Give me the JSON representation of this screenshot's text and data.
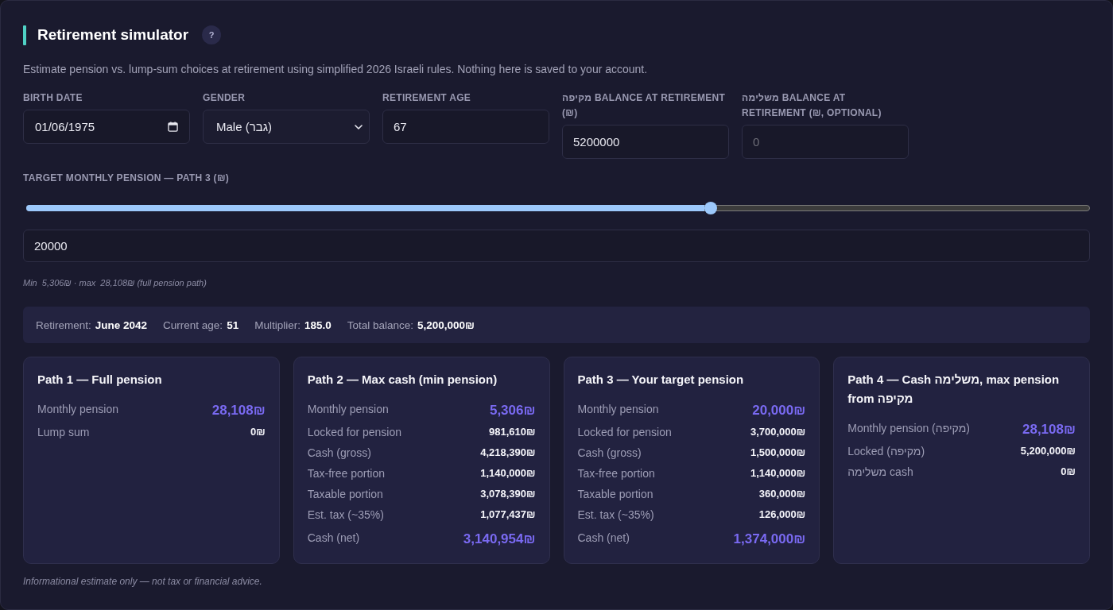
{
  "header": {
    "title": "Retirement simulator",
    "help_button": "?"
  },
  "description": "Estimate pension vs. lump-sum choices at retirement using simplified 2026 Israeli rules. Nothing here is saved to your account.",
  "fields": [
    {
      "kind": "date",
      "label": "BIRTH DATE",
      "value": "01/06/1975"
    },
    {
      "kind": "select",
      "label": "GENDER",
      "value": "Male (גבר)"
    },
    {
      "kind": "number",
      "label": "RETIREMENT AGE",
      "value": "67"
    },
    {
      "kind": "number",
      "label": "מקיפה BALANCE AT RETIREMENT (₪)",
      "value": "5200000"
    },
    {
      "kind": "number",
      "label": "משלימה BALANCE AT RETIREMENT (₪, OPTIONAL)",
      "placeholder": "0"
    }
  ],
  "target_pension": {
    "label": "TARGET MONTHLY PENSION — PATH 3 (₪)",
    "level": 0.644,
    "value": "20000",
    "hint": "Min  5,306₪ · max  28,108₪ (full pension path)"
  },
  "summary": [
    {
      "label": "Retirement:",
      "value": "June 2042"
    },
    {
      "label": "Current age:",
      "value": "51"
    },
    {
      "label": "Multiplier:",
      "value": "185.0"
    },
    {
      "label": "Total balance:",
      "value": "5,200,000₪"
    }
  ],
  "paths": [
    {
      "title": "Path 1 — Full pension",
      "rows": [
        {
          "kind": "accent",
          "label": "Monthly pension",
          "value": "28,108₪"
        },
        {
          "kind": "plain",
          "label": "Lump sum",
          "value": "0₪"
        }
      ]
    },
    {
      "title": "Path 2 — Max cash (min pension)",
      "rows": [
        {
          "kind": "accent",
          "label": "Monthly pension",
          "value": "5,306₪"
        },
        {
          "kind": "plain",
          "label": "Locked for pension",
          "value": "981,610₪"
        },
        {
          "kind": "plain",
          "label": "Cash (gross)",
          "value": "4,218,390₪"
        },
        {
          "kind": "plain",
          "label": "Tax-free portion",
          "value": "1,140,000₪"
        },
        {
          "kind": "plain",
          "label": "Taxable portion",
          "value": "3,078,390₪"
        },
        {
          "kind": "plain",
          "label": "Est. tax (~35%)",
          "value": "1,077,437₪"
        },
        {
          "kind": "accent",
          "label": "Cash (net)",
          "value": "3,140,954₪"
        }
      ]
    },
    {
      "title": "Path 3 — Your target pension",
      "rows": [
        {
          "kind": "accent",
          "label": "Monthly pension",
          "value": "20,000₪"
        },
        {
          "kind": "plain",
          "label": "Locked for pension",
          "value": "3,700,000₪"
        },
        {
          "kind": "plain",
          "label": "Cash (gross)",
          "value": "1,500,000₪"
        },
        {
          "kind": "plain",
          "label": "Tax-free portion",
          "value": "1,140,000₪"
        },
        {
          "kind": "plain",
          "label": "Taxable portion",
          "value": "360,000₪"
        },
        {
          "kind": "plain",
          "label": "Est. tax (~35%)",
          "value": "126,000₪"
        },
        {
          "kind": "accent",
          "label": "Cash (net)",
          "value": "1,374,000₪"
        }
      ]
    },
    {
      "title": "Path 4 — Cash משלימה, max pension from מקיפה",
      "rows": [
        {
          "kind": "accent",
          "label": "Monthly pension (מקיפה)",
          "value": "28,108₪"
        },
        {
          "kind": "plain",
          "label": "Locked (מקיפה)",
          "value": "5,200,000₪"
        },
        {
          "kind": "plain",
          "label": "משלימה cash",
          "value": "0₪"
        }
      ]
    }
  ],
  "footer": "Informational estimate only — not tax or financial advice."
}
